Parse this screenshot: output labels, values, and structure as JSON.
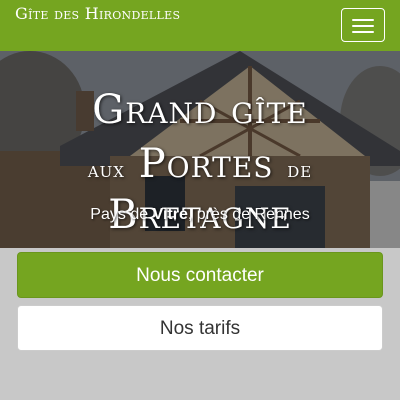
{
  "navbar": {
    "brand": "Gîte des Hirondelles",
    "menu_icon": "hamburger-menu-icon",
    "accent_color": "#75a520"
  },
  "hero": {
    "title_line1": "Grand gîte",
    "title_line2_prefix": "aux",
    "title_line2_main": "Portes",
    "title_line2_connector": "de",
    "title_line2_end": "Bretagne",
    "subtitle_prefix": "Pays de ",
    "subtitle_bold": "Vitré",
    "subtitle_suffix": ", près de Rennes"
  },
  "actions": {
    "contact_label": "Nous contacter",
    "tarifs_label": "Nos tarifs"
  }
}
